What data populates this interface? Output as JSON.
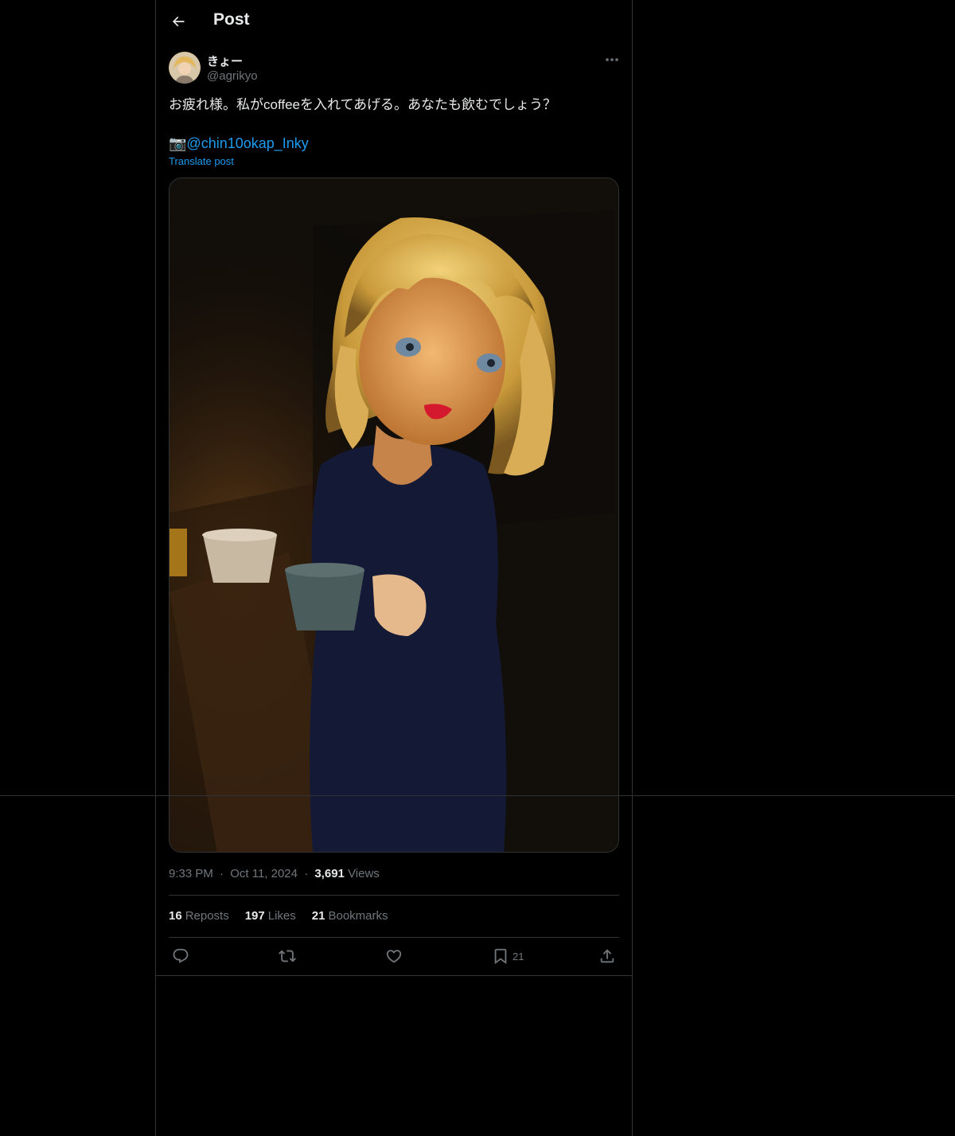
{
  "header": {
    "title": "Post"
  },
  "author": {
    "display_name": "きょー",
    "handle": "@agrikyo"
  },
  "post": {
    "text": "お疲れ様。私がcoffeeを入れてあげる。あなたも飲むでしょう？",
    "camera_emoji": "📷",
    "mention": "@chin10okap_Inky",
    "translate_label": "Translate post",
    "photo_alt": "Image"
  },
  "meta": {
    "time": "9:33 PM",
    "dot1": "·",
    "date": "Oct 11, 2024",
    "dot2": "·",
    "views_count": "3,691",
    "views_label": "Views"
  },
  "stats": {
    "reposts_count": "16",
    "reposts_label": "Reposts",
    "likes_count": "197",
    "likes_label": "Likes",
    "bookmarks_count": "21",
    "bookmarks_label": "Bookmarks"
  },
  "actions": {
    "bookmark_count": "21"
  },
  "colors": {
    "accent": "#1d9bf0",
    "muted": "#71767b",
    "border": "#2f3336",
    "text": "#e7e9ea",
    "background": "#000000"
  },
  "icons": {
    "back": "arrow-left-icon",
    "more": "ellipsis-icon",
    "reply": "reply-icon",
    "repost": "repost-icon",
    "like": "heart-icon",
    "bookmark": "bookmark-icon",
    "share": "share-icon"
  }
}
